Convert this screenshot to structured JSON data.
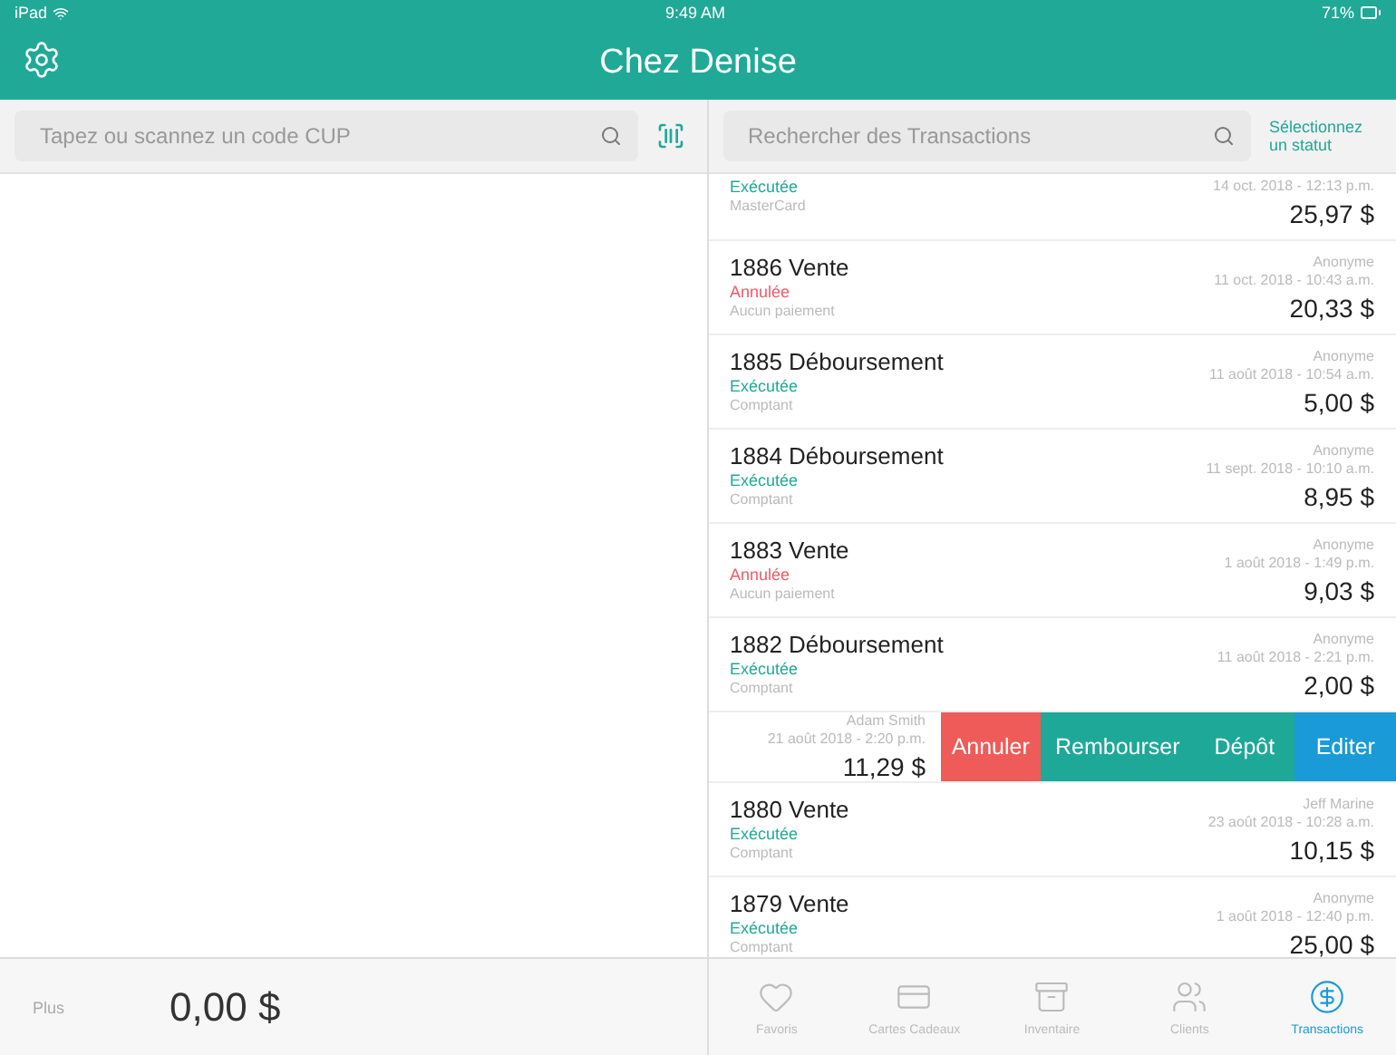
{
  "status_bar": {
    "device": "iPad",
    "time": "9:49 AM",
    "battery": "71%"
  },
  "header": {
    "title": "Chez Denise"
  },
  "left_pane": {
    "search": {
      "placeholder": "Tapez ou scannez un code CUP"
    },
    "footer": {
      "label": "Plus",
      "total": "0,00 $"
    }
  },
  "right_pane": {
    "search": {
      "placeholder": "Rechercher des Transactions"
    },
    "status_filter": "Sélectionnez un statut",
    "transactions": [
      {
        "kind": "partial",
        "status": "Exécutée",
        "cancelled": false,
        "payment": "MasterCard",
        "date": "14 oct. 2018 - 12:13 p.m.",
        "amount": "25,97 $"
      },
      {
        "kind": "full",
        "title": "1886 Vente",
        "status": "Annulée",
        "cancelled": true,
        "payment": "Aucun paiement",
        "customer": "Anonyme",
        "date": "11 oct. 2018 - 10:43 a.m.",
        "amount": "20,33 $"
      },
      {
        "kind": "full",
        "title": "1885 Déboursement",
        "status": "Exécutée",
        "cancelled": false,
        "payment": "Comptant",
        "customer": "Anonyme",
        "date": "11 août 2018 - 10:54 a.m.",
        "amount": "5,00 $"
      },
      {
        "kind": "full",
        "title": "1884 Déboursement",
        "status": "Exécutée",
        "cancelled": false,
        "payment": "Comptant",
        "customer": "Anonyme",
        "date": "11 sept. 2018 - 10:10 a.m.",
        "amount": "8,95 $"
      },
      {
        "kind": "full",
        "title": "1883 Vente",
        "status": "Annulée",
        "cancelled": true,
        "payment": "Aucun paiement",
        "customer": "Anonyme",
        "date": "1 août 2018 - 1:49 p.m.",
        "amount": "9,03 $"
      },
      {
        "kind": "full",
        "title": "1882 Déboursement",
        "status": "Exécutée",
        "cancelled": false,
        "payment": "Comptant",
        "customer": "Anonyme",
        "date": "11 août 2018 - 2:21 p.m.",
        "amount": "2,00 $"
      },
      {
        "kind": "swiped",
        "customer": "Adam Smith",
        "date": "21 août 2018 - 2:20 p.m.",
        "amount": "11,29 $",
        "actions": [
          {
            "label": "Annuler",
            "color": "#ee5b58"
          },
          {
            "label": "Rembourser",
            "color": "#1ea898"
          },
          {
            "label": "Dépôt",
            "color": "#1ea898"
          },
          {
            "label": "Editer",
            "color": "#1a9bd7"
          }
        ]
      },
      {
        "kind": "full",
        "title": "1880 Vente",
        "status": "Exécutée",
        "cancelled": false,
        "payment": "Comptant",
        "customer": "Jeff Marine",
        "date": "23 août 2018 - 10:28 a.m.",
        "amount": "10,15 $"
      },
      {
        "kind": "full",
        "title": "1879 Vente",
        "status": "Exécutée",
        "cancelled": false,
        "payment": "Comptant",
        "customer": "Anonyme",
        "date": "1 août 2018 - 12:40 p.m.",
        "amount": "25,00 $"
      }
    ]
  },
  "tab_bar": [
    {
      "label": "Favoris",
      "selected": false
    },
    {
      "label": "Cartes Cadeaux",
      "selected": false
    },
    {
      "label": "Inventaire",
      "selected": false
    },
    {
      "label": "Clients",
      "selected": false
    },
    {
      "label": "Transactions",
      "selected": true
    }
  ]
}
